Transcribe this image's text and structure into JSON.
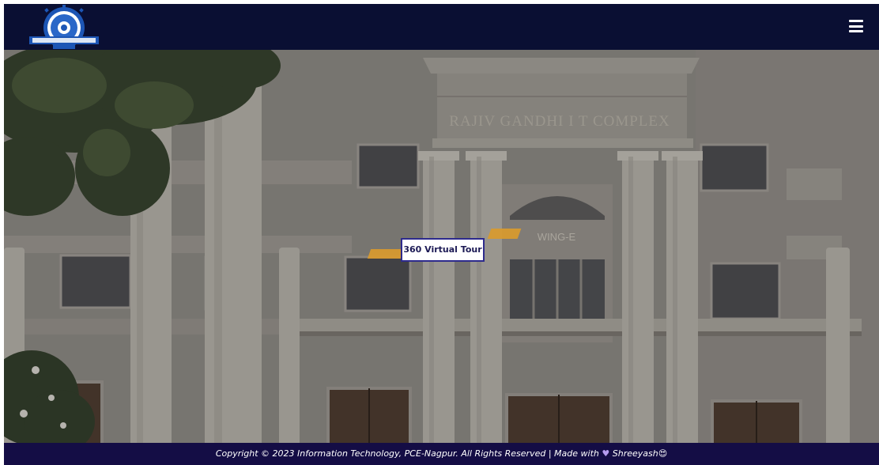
{
  "header": {
    "logo_icon": "college-seal-logo",
    "menu_icon": "hamburger-menu-icon"
  },
  "scene": {
    "building_name": "RAJIV GANDHI I T COMPLEX",
    "wing_label": "WING-E",
    "tour_button_label": "360 Virtual Tour"
  },
  "footer": {
    "copyright_text": "Copyright © 2023 Information Technology, PCE-Nagpur. All Rights Reserved | Made with",
    "heart_icon": "♥",
    "author": "Shreeyash",
    "emoji_icon": "😍"
  },
  "colors": {
    "header_bg": "#0a0f33",
    "footer_bg": "#140d45",
    "button_border": "#2d2a8c",
    "hotspot": "#d99a2e"
  }
}
